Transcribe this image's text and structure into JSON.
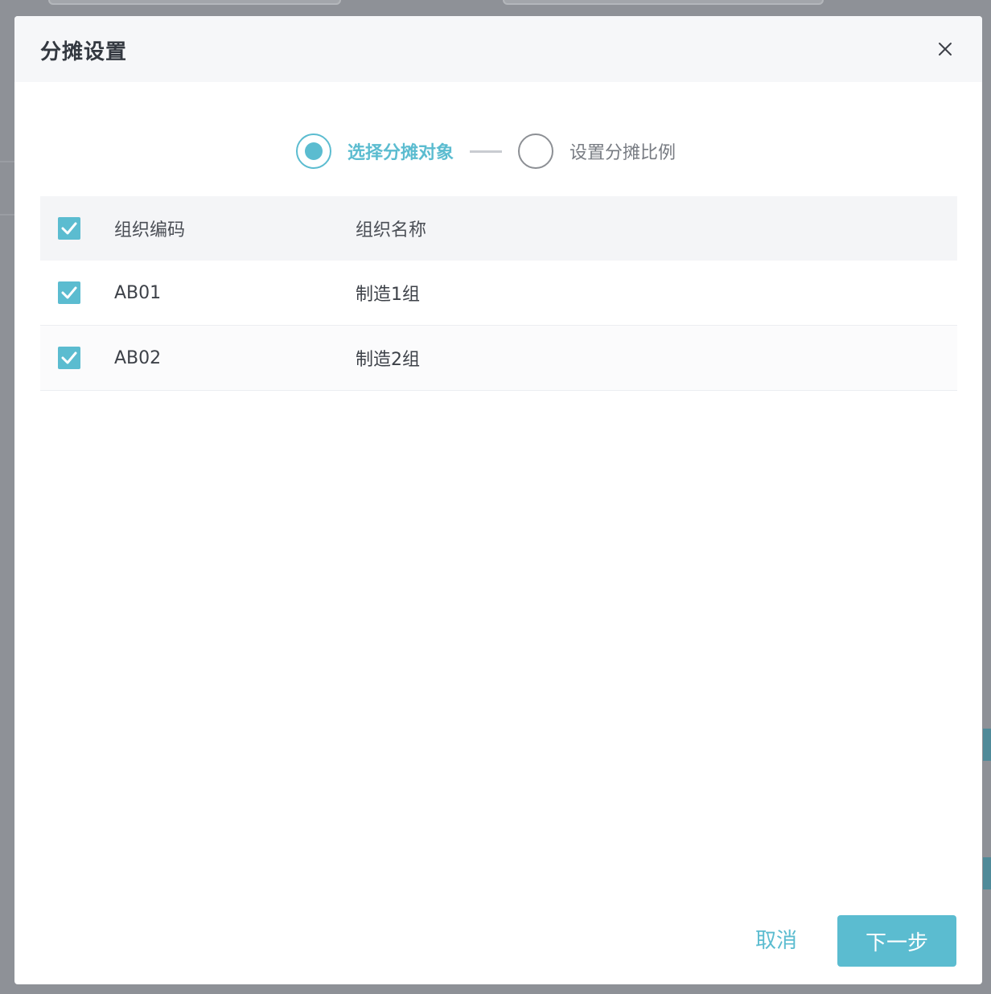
{
  "modal": {
    "title": "分摊设置"
  },
  "steps": [
    {
      "label": "选择分摊对象",
      "state": "active"
    },
    {
      "label": "设置分摊比例",
      "state": "inactive"
    }
  ],
  "table": {
    "columns": [
      "组织编码",
      "组织名称"
    ],
    "header_checked": true,
    "rows": [
      {
        "checked": true,
        "code": "AB01",
        "name": "制造1组"
      },
      {
        "checked": true,
        "code": "AB02",
        "name": "制造2组"
      }
    ]
  },
  "footer": {
    "cancel_label": "取消",
    "next_label": "下一步"
  },
  "colors": {
    "accent": "#5bbcd0",
    "overlay": "#8e9197"
  },
  "icons": {
    "close": "close-icon",
    "check": "checkmark-icon"
  }
}
